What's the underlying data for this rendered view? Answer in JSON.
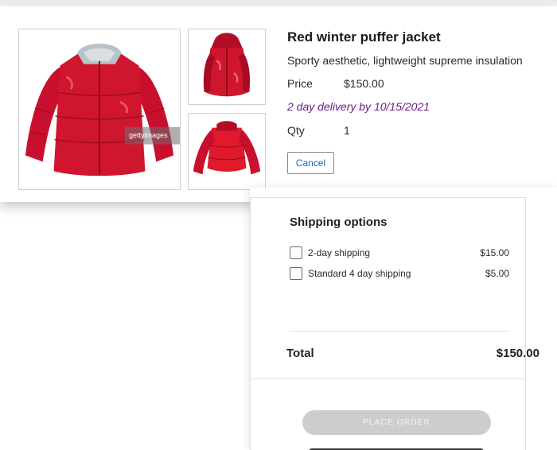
{
  "product": {
    "title": "Red winter puffer jacket",
    "subtitle": "Sporty aesthetic, lightweight supreme insulation",
    "price_label": "Price",
    "price_value": "$150.00",
    "delivery": "2 day delivery by 10/15/2021",
    "qty_label": "Qty",
    "qty_value": "1",
    "cancel_label": "Cancel",
    "watermark": "gettyimages",
    "images": {
      "main": "red-jacket-front-image",
      "thumb1": "red-jacket-hood-image",
      "thumb2": "red-jacket-back-image"
    },
    "colors": {
      "jacket": "#c8102e",
      "delivery_text": "#6a1b8a",
      "cancel_text": "#1565c0"
    }
  },
  "shipping": {
    "heading": "Shipping options",
    "options": [
      {
        "label": "2-day shipping",
        "price": "$15.00",
        "checked": false
      },
      {
        "label": "Standard 4 day shipping",
        "price": "$5.00",
        "checked": false
      }
    ],
    "total_label": "Total",
    "total_value": "$150.00",
    "place_order_label": "PLACE ORDER",
    "place_order_disabled": true
  }
}
